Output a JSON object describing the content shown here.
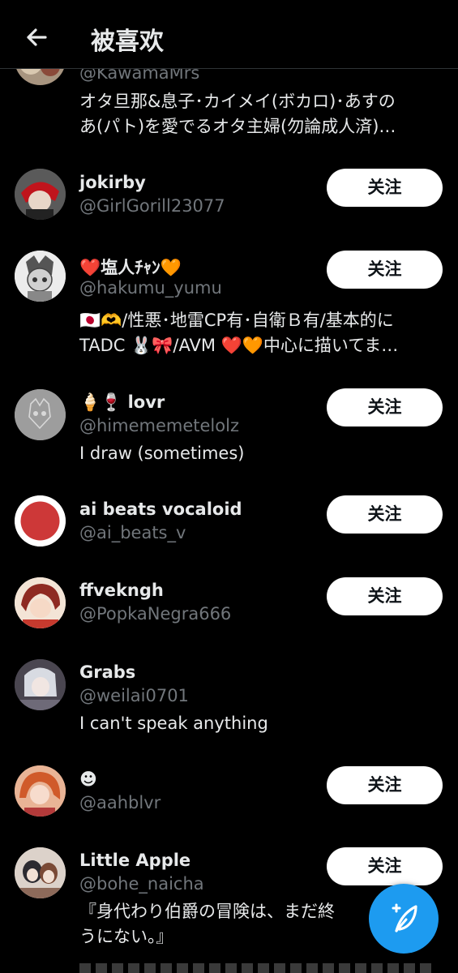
{
  "header": {
    "title": "被喜欢",
    "back_icon": "arrow-left-icon"
  },
  "follow_label": "关注",
  "users": [
    {
      "name": "",
      "handle": "@KawamaMrs",
      "bio_lines": [
        "オタ旦那&息子･カイメイ(ボカロ)･あすの",
        "あ(パト)を愛でるオタ主婦(勿論成人済)…"
      ]
    },
    {
      "name": "jokirby",
      "handle": "@GirlGorill23077",
      "bio_lines": []
    },
    {
      "name": "❤️塩人ﾁｬﾝ🧡",
      "handle": "@hakumu_yumu",
      "bio_lines": [
        "🇯🇵🫶/性悪･地雷CP有･自衛Ｂ有/基本的に",
        "TADC 🐰🎀/AVM ❤️🧡中心に描いてま…"
      ]
    },
    {
      "name": "🍦🍷 lovr",
      "handle": "@himememetelolz",
      "bio_lines": [
        "I draw (sometimes)"
      ]
    },
    {
      "name": "ai beats vocaloid",
      "handle": "@ai_beats_v",
      "bio_lines": []
    },
    {
      "name": "ffvekngh",
      "handle": "@PopkaNegra666",
      "bio_lines": []
    },
    {
      "name": "Grabs",
      "handle": "@weilai0701",
      "bio_lines": [
        "I can't speak anything"
      ]
    },
    {
      "name": "☻",
      "handle": "@aahblvr",
      "bio_lines": []
    },
    {
      "name": "Little Apple",
      "handle": "@bohe_naicha",
      "bio_lines": [
        "『身代わり伯爵の冒険は、まだ終",
        "うにない。』"
      ]
    }
  ],
  "colors": {
    "background": "#000000",
    "text": "#e7e9ea",
    "secondary": "#71767b",
    "accent": "#1d9bf0",
    "button_bg": "#ffffff"
  },
  "fab_icon": "compose-feather-icon"
}
